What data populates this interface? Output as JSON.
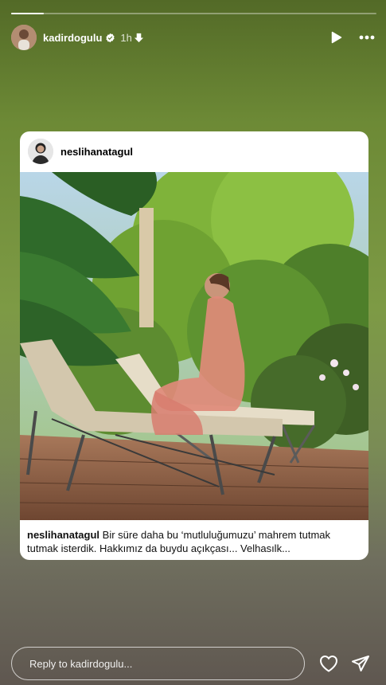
{
  "story": {
    "progress_fraction": 0.09,
    "user": "kadirdogulu",
    "time": "1h",
    "verified": true
  },
  "card": {
    "user": "neslihanatagul",
    "caption_user": "neslihanatagul",
    "caption_text": " Bir süre daha bu ‘mutluluğumuzu’ mahrem tutmak tutmak isterdik. Hakkımız da buydu açıkçası... Velhasılk..."
  },
  "reply": {
    "placeholder": "Reply to kadirdogulu..."
  },
  "icons": {
    "verified": "verified-badge-icon",
    "download": "download-icon",
    "play": "play-icon",
    "more": "more-icon",
    "like": "heart-icon",
    "share": "send-icon"
  },
  "colors": {
    "background_top": "#536a27",
    "background_bottom": "#5f5750",
    "verified": "#ffffff"
  }
}
